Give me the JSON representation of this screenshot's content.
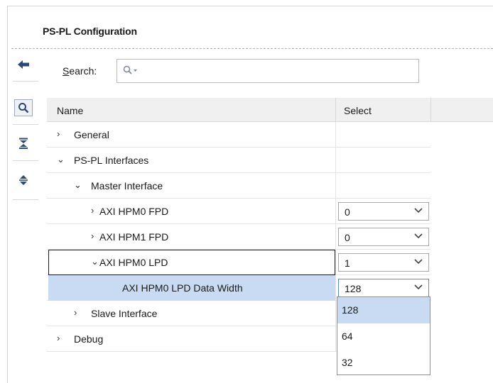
{
  "panel": {
    "title": "PS-PL Configuration"
  },
  "toolbar": {
    "back_icon": "arrow-left-icon",
    "search_icon": "magnifier-icon",
    "collapse_all_icon": "collapse-all-icon",
    "expand_all_icon": "expand-all-icon"
  },
  "search": {
    "label_prefix": "S",
    "label_rest": "earch:",
    "value": ""
  },
  "table": {
    "columns": [
      "Name",
      "Select"
    ],
    "rows": [
      {
        "arrow": "›",
        "label": "General"
      },
      {
        "arrow": "⌄",
        "label": "PS-PL Interfaces"
      },
      {
        "arrow": "⌄",
        "label": "Master Interface"
      },
      {
        "arrow": "›",
        "label": "AXI HPM0 FPD",
        "value": "0"
      },
      {
        "arrow": "›",
        "label": "AXI HPM1 FPD",
        "value": "0"
      },
      {
        "arrow": "⌄",
        "label": "AXI HPM0 LPD",
        "value": "1"
      },
      {
        "arrow": "",
        "label": "AXI HPM0 LPD Data Width",
        "value": "128"
      },
      {
        "arrow": "›",
        "label": "Slave Interface"
      },
      {
        "arrow": "›",
        "label": "Debug"
      }
    ]
  },
  "dropdown": {
    "options": [
      "128",
      "64",
      "32"
    ],
    "selected": "128"
  },
  "colors": {
    "selection": "#c9dbf2",
    "combo_focus": "#5b8bd1",
    "header_bg": "#f0f0f0"
  }
}
